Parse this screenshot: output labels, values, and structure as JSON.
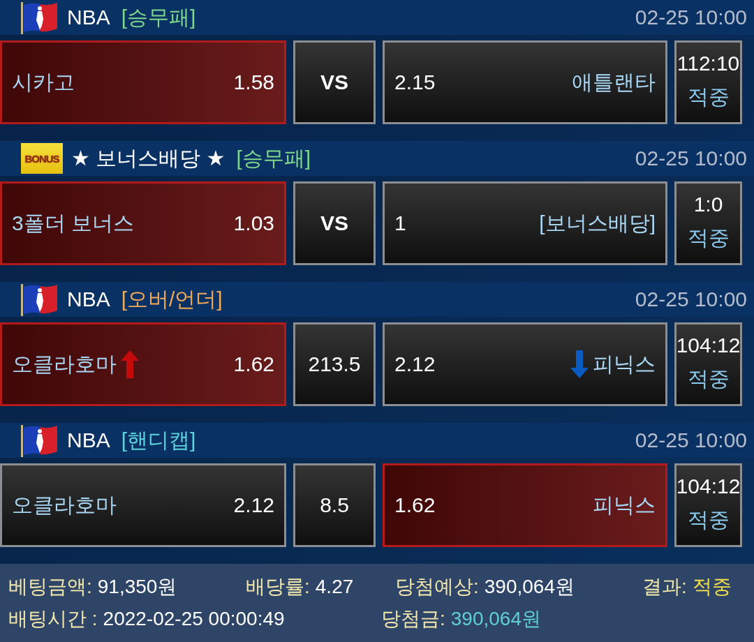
{
  "bets": [
    {
      "league_icon": {
        "kind": "flag"
      },
      "league": "NBA",
      "market": {
        "label": "[승무패]",
        "color": "#7fd88a"
      },
      "time": "02-25 10:00",
      "home": {
        "name": "시카고",
        "odds": "1.58",
        "selected": true
      },
      "center": {
        "kind": "vs",
        "text": "VS"
      },
      "away": {
        "odds": "2.15",
        "name": "애틀랜타",
        "selected": false
      },
      "result": {
        "score": "112:10",
        "status": "적중"
      }
    },
    {
      "league_icon": {
        "kind": "badge",
        "text": "BONUS"
      },
      "league": "★ 보너스배당 ★",
      "market": {
        "label": "[승무패]",
        "color": "#7fd88a"
      },
      "time": "02-25 10:00",
      "home": {
        "name": "3폴더 보너스",
        "odds": "1.03",
        "selected": true
      },
      "center": {
        "kind": "vs",
        "text": "VS"
      },
      "away": {
        "odds": "1",
        "name": "[보너스배당]",
        "selected": false
      },
      "result": {
        "score": "1:0",
        "status": "적중"
      }
    },
    {
      "league_icon": {
        "kind": "flag"
      },
      "league": "NBA",
      "market": {
        "label": "[오버/언더]",
        "color": "#f0aa58"
      },
      "time": "02-25 10:00",
      "home": {
        "name": "오클라호마",
        "odds": "1.62",
        "selected": true,
        "arrow": {
          "kind": "up"
        }
      },
      "center": {
        "kind": "line",
        "text": "213.5"
      },
      "away": {
        "odds": "2.12",
        "name": "피닉스",
        "selected": false,
        "arrow": {
          "kind": "down"
        }
      },
      "result": {
        "score": "104:12",
        "status": "적중"
      }
    },
    {
      "league_icon": {
        "kind": "flag"
      },
      "league": "NBA",
      "market": {
        "label": "[핸디캡]",
        "color": "#5fd3dc"
      },
      "time": "02-25 10:00",
      "home": {
        "name": "오클라호마",
        "odds": "2.12",
        "selected": false
      },
      "center": {
        "kind": "line",
        "text": "8.5"
      },
      "away": {
        "odds": "1.62",
        "name": "피닉스",
        "selected": true
      },
      "result": {
        "score": "104:12",
        "status": "적중"
      }
    }
  ],
  "summary": [
    {
      "label": "베팅금액:",
      "value": "91,350원",
      "color": "#ffffff"
    },
    {
      "label": "배당률:",
      "value": "4.27",
      "color": "#ffffff"
    },
    {
      "label": "당첨예상:",
      "value": "390,064원",
      "color": "#ffffff"
    },
    {
      "label": "결과:",
      "value": "적중",
      "color": "#f5e04a"
    },
    {
      "label": "배팅시간 :",
      "value": "2022-02-25 00:00:49",
      "color": "#ffffff"
    },
    {
      "label": "당첨금:",
      "value": "390,064원",
      "color": "#5fd0d2"
    }
  ]
}
